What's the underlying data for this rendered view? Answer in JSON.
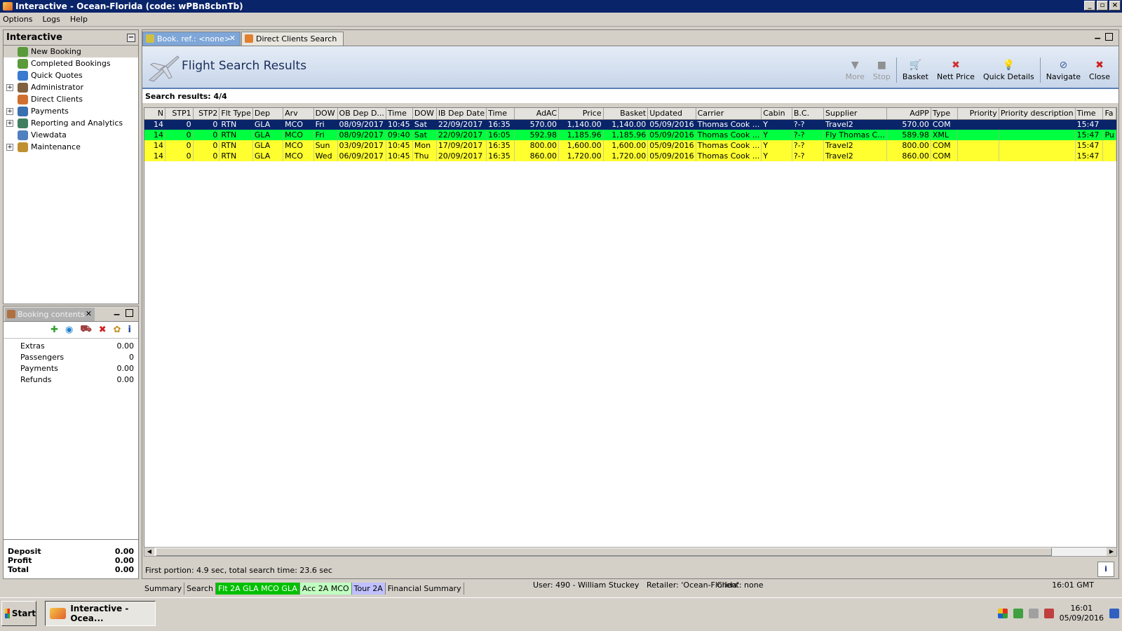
{
  "window": {
    "title": "Interactive - Ocean-Florida (code: wPBn8cbnTb)"
  },
  "menu": [
    "Options",
    "Logs",
    "Help"
  ],
  "sidebar": {
    "title": "Interactive",
    "items": [
      {
        "label": "New Booking",
        "expand": false,
        "color": "#5a9a3a"
      },
      {
        "label": "Completed Bookings",
        "expand": false,
        "color": "#5a9a3a"
      },
      {
        "label": "Quick Quotes",
        "expand": false,
        "color": "#3a7ad0"
      },
      {
        "label": "Administrator",
        "expand": true,
        "color": "#806040"
      },
      {
        "label": "Direct Clients",
        "expand": false,
        "color": "#d07030"
      },
      {
        "label": "Payments",
        "expand": true,
        "color": "#3a70b0"
      },
      {
        "label": "Reporting and Analytics",
        "expand": true,
        "color": "#408060"
      },
      {
        "label": "Viewdata",
        "expand": false,
        "color": "#5080c0"
      },
      {
        "label": "Maintenance",
        "expand": true,
        "color": "#c09030"
      }
    ]
  },
  "booking": {
    "tab_label": "Booking contents",
    "rows": [
      {
        "label": "Extras",
        "value": "0.00"
      },
      {
        "label": "Passengers",
        "value": "0"
      },
      {
        "label": "Payments",
        "value": "0.00"
      },
      {
        "label": "Refunds",
        "value": "0.00"
      }
    ],
    "footer": [
      {
        "label": "Deposit",
        "value": "0.00"
      },
      {
        "label": "Profit",
        "value": "0.00"
      },
      {
        "label": "Total",
        "value": "0.00"
      }
    ]
  },
  "tabs": {
    "tab1": "Book. ref.: <none>",
    "tab2": "Direct Clients Search"
  },
  "header": {
    "title": "Flight Search Results"
  },
  "toolbar": [
    {
      "label": "More",
      "icon": "▼",
      "disabled": true
    },
    {
      "label": "Stop",
      "icon": "■",
      "disabled": true
    },
    {
      "label": "Basket",
      "icon": "🛒",
      "disabled": false
    },
    {
      "label": "Nett Price",
      "icon": "✖",
      "disabled": false
    },
    {
      "label": "Quick Details",
      "icon": "💡",
      "disabled": false
    },
    {
      "label": "Navigate",
      "icon": "⊘",
      "disabled": false
    },
    {
      "label": "Close",
      "icon": "✖",
      "disabled": false
    }
  ],
  "results": {
    "label": "Search results: 4/4",
    "columns": [
      "N",
      "STP1",
      "STP2",
      "Flt Type",
      "Dep",
      "Arv",
      "DOW",
      "OB Dep D...",
      "Time",
      "DOW",
      "IB Dep Date",
      "Time",
      "AdAC",
      "Price",
      "Basket",
      "Updated",
      "Carrier",
      "Cabin",
      "B.C.",
      "Supplier",
      "AdPP",
      "Type",
      "Priority",
      "Priority description",
      "Time",
      "Fa"
    ],
    "rows": [
      {
        "style": "sel",
        "cells": [
          "14",
          "0",
          "0",
          "RTN",
          "GLA",
          "MCO",
          "Fri",
          "08/09/2017",
          "10:45",
          "Sat",
          "22/09/2017",
          "16:35",
          "570.00",
          "1,140.00",
          "1,140.00",
          "05/09/2016",
          "Thomas Cook ...",
          "Y",
          "?-?",
          "Travel2",
          "570.00",
          "COM",
          "",
          "",
          "15:47",
          ""
        ]
      },
      {
        "style": "green",
        "cells": [
          "14",
          "0",
          "0",
          "RTN",
          "GLA",
          "MCO",
          "Fri",
          "08/09/2017",
          "09:40",
          "Sat",
          "22/09/2017",
          "16:05",
          "592.98",
          "1,185.96",
          "1,185.96",
          "05/09/2016",
          "Thomas Cook ...",
          "Y",
          "?-?",
          "Fly Thomas C...",
          "589.98",
          "XML",
          "",
          "",
          "15:47",
          "Pu"
        ]
      },
      {
        "style": "yellow",
        "cells": [
          "14",
          "0",
          "0",
          "RTN",
          "GLA",
          "MCO",
          "Sun",
          "03/09/2017",
          "10:45",
          "Mon",
          "17/09/2017",
          "16:35",
          "800.00",
          "1,600.00",
          "1,600.00",
          "05/09/2016",
          "Thomas Cook ...",
          "Y",
          "?-?",
          "Travel2",
          "800.00",
          "COM",
          "",
          "",
          "15:47",
          ""
        ]
      },
      {
        "style": "yellow",
        "cells": [
          "14",
          "0",
          "0",
          "RTN",
          "GLA",
          "MCO",
          "Wed",
          "06/09/2017",
          "10:45",
          "Thu",
          "20/09/2017",
          "16:35",
          "860.00",
          "1,720.00",
          "1,720.00",
          "05/09/2016",
          "Thomas Cook ...",
          "Y",
          "?-?",
          "Travel2",
          "860.00",
          "COM",
          "",
          "",
          "15:47",
          ""
        ]
      }
    ]
  },
  "status_line": "First portion: 4.9 sec, total search time: 23.6 sec",
  "bottom_tabs": [
    {
      "label": "Summary",
      "style": ""
    },
    {
      "label": "Search",
      "style": ""
    },
    {
      "label": "Flt 2A GLA MCO GLA",
      "style": "g"
    },
    {
      "label": "Acc 2A MCO",
      "style": "lg"
    },
    {
      "label": "Tour 2A",
      "style": "bl"
    },
    {
      "label": "Financial Summary",
      "style": ""
    }
  ],
  "statusbar": {
    "user": "User: 490 - William Stuckey",
    "retailer": "Retailer: 'Ocean-Florida'",
    "client": "Client: none",
    "time": "16:01 GMT"
  },
  "taskbar": {
    "start": "Start",
    "item": "Interactive - Ocea...",
    "clock_time": "16:01",
    "clock_date": "05/09/2016"
  }
}
